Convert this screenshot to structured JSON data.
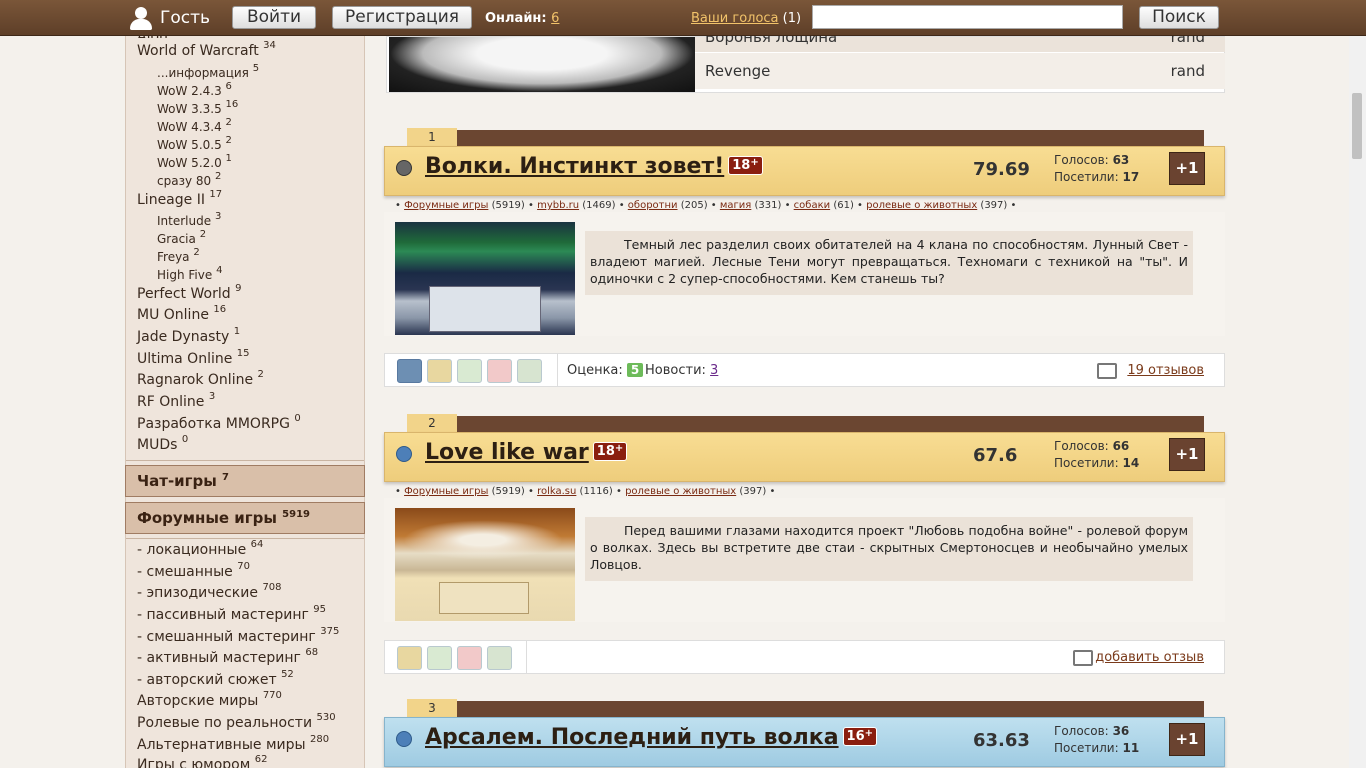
{
  "topbar": {
    "user_label": "Гость",
    "login_label": "Войти",
    "register_label": "Регистрация",
    "online_label": "Онлайн:",
    "online_count": "6",
    "votes_link": "Ваши голоса",
    "votes_count": "(1)",
    "search_value": "",
    "search_button": "Поиск"
  },
  "sidebar": {
    "top_cut": "Aion",
    "items": [
      {
        "label": "World of Warcraft",
        "count": "34"
      },
      {
        "label": "...информация",
        "count": "5"
      },
      {
        "label": "WoW 2.4.3",
        "count": "6"
      },
      {
        "label": "WoW 3.3.5",
        "count": "16"
      },
      {
        "label": "WoW 4.3.4",
        "count": "2"
      },
      {
        "label": "WoW 5.0.5",
        "count": "2"
      },
      {
        "label": "WoW 5.2.0",
        "count": "1"
      },
      {
        "label": "сразу 80",
        "count": "2"
      },
      {
        "label": "Lineage II",
        "count": "17"
      },
      {
        "label": "Interlude",
        "count": "3"
      },
      {
        "label": "Gracia",
        "count": "2"
      },
      {
        "label": "Freya",
        "count": "2"
      },
      {
        "label": "High Five",
        "count": "4"
      },
      {
        "label": "Perfect World",
        "count": "9"
      },
      {
        "label": "MU Online",
        "count": "16"
      },
      {
        "label": "Jade Dynasty",
        "count": "1"
      },
      {
        "label": "Ultima Online",
        "count": "15"
      },
      {
        "label": "Ragnarok Online",
        "count": "2"
      },
      {
        "label": "RF Online",
        "count": "3"
      },
      {
        "label": "Разработка MMORPG",
        "count": "0"
      },
      {
        "label": "MUDs",
        "count": "0"
      }
    ],
    "cat_chat": {
      "label": "Чат-игры",
      "count": "7"
    },
    "cat_forum": {
      "label": "Форумные игры",
      "count": "5919"
    },
    "forum_items": [
      {
        "label": "- локационные",
        "count": "64"
      },
      {
        "label": "- смешанные",
        "count": "70"
      },
      {
        "label": "- эпизодические",
        "count": "708"
      },
      {
        "label": "- пассивный мастеринг",
        "count": "95"
      },
      {
        "label": "- смешанный мастеринг",
        "count": "375"
      },
      {
        "label": "- активный мастеринг",
        "count": "68"
      },
      {
        "label": "- авторский сюжет",
        "count": "52"
      },
      {
        "label": "Авторские миры",
        "count": "770"
      },
      {
        "label": "Ролевые по реальности",
        "count": "530"
      },
      {
        "label": "Альтернативные миры",
        "count": "280"
      },
      {
        "label": "Игры с юмором",
        "count": "62"
      }
    ]
  },
  "prevcard": {
    "row_top_left": "Воронья лощина",
    "row_top_right": "rand",
    "name": "Revenge",
    "type": "rand"
  },
  "cards": [
    {
      "rank": "1",
      "title": "Волки. Инстинкт зовет!",
      "age": "18",
      "score": "79.69",
      "votes_label": "Голосов:",
      "votes": "63",
      "visitors_label": "Посетили:",
      "visitors": "17",
      "plus": "+1",
      "tags": [
        {
          "name": "Форумные игры",
          "count": "(5919)"
        },
        {
          "name": "mybb.ru",
          "count": "(1469)"
        },
        {
          "name": "оборотни",
          "count": "(205)"
        },
        {
          "name": "магия",
          "count": "(331)"
        },
        {
          "name": "собаки",
          "count": "(61)"
        },
        {
          "name": "ролевые о животных",
          "count": "(397)"
        }
      ],
      "description": "Темный лес разделил своих обитателей на 4 клана по способностям. Лунный Свет - владеют магией. Лесные Тени могут превращаться. Техномаги с техникой на \"ты\". И одиночки с 2 супер-способностями. Кем станешь ты?",
      "rating_label": "Оценка:",
      "rating": "5",
      "news_label": "Новости:",
      "news": "3",
      "reviews": "19 отзывов"
    },
    {
      "rank": "2",
      "title": "Love like war",
      "age": "18",
      "score": "67.6",
      "votes_label": "Голосов:",
      "votes": "66",
      "visitors_label": "Посетили:",
      "visitors": "14",
      "plus": "+1",
      "tags": [
        {
          "name": "Форумные игры",
          "count": "(5919)"
        },
        {
          "name": "rolka.su",
          "count": "(1116)"
        },
        {
          "name": "ролевые о животных",
          "count": "(397)"
        }
      ],
      "description": "Перед вашими глазами находится проект \"Любовь подобна войне\" - ролевой форум о волках. Здесь вы встретите две стаи - скрытных Смертоносцев и необычайно умелых Ловцов.",
      "reviews": "добавить отзыв"
    },
    {
      "rank": "3",
      "title": "Арсалем. Последний путь волка",
      "age": "16",
      "score": "63.63",
      "votes_label": "Голосов:",
      "votes": "36",
      "visitors_label": "Посетили:",
      "visitors": "11",
      "plus": "+1"
    }
  ]
}
